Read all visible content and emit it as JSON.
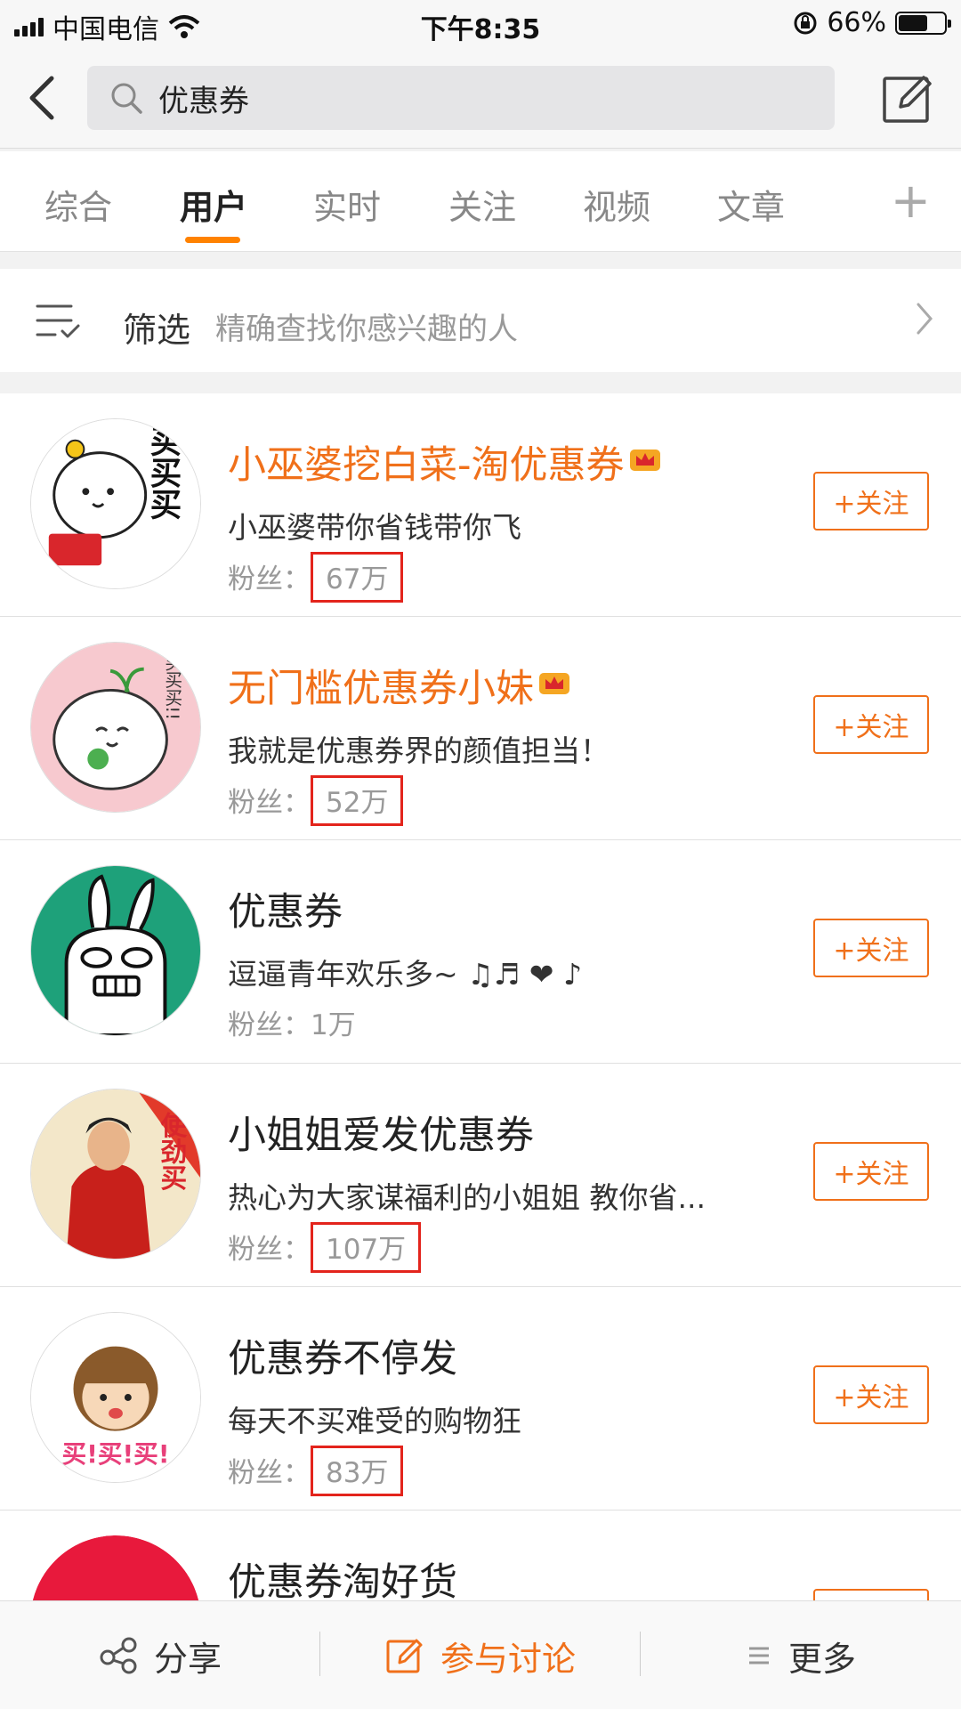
{
  "status_bar": {
    "carrier": "中国电信",
    "time": "下午8:35",
    "battery": "66%",
    "battery_level": 0.66
  },
  "search": {
    "query": "优惠券"
  },
  "tabs": [
    {
      "label": "综合"
    },
    {
      "label": "用户"
    },
    {
      "label": "实时"
    },
    {
      "label": "关注"
    },
    {
      "label": "视频"
    },
    {
      "label": "文章"
    }
  ],
  "tabs_plus": "+",
  "filter": {
    "title": "筛选",
    "hint": "精确查找你感兴趣的人"
  },
  "results": [
    {
      "name": "小巫婆挖白菜-淘优惠券",
      "desc": "小巫婆带你省钱带你飞",
      "fans_label": "粉丝：",
      "fans": "67万",
      "follow": "+关注"
    },
    {
      "name": "无门槛优惠券小妹",
      "desc": "我就是优惠券界的颜值担当！",
      "fans_label": "粉丝：",
      "fans": "52万",
      "follow": "+关注"
    },
    {
      "name": "优惠券",
      "desc": "逗逼青年欢乐多~ ♫♬ ❤ ♪",
      "fans_label": "粉丝：",
      "fans": "1万",
      "follow": "+关注"
    },
    {
      "name": "小姐姐爱发优惠券",
      "desc": "热心为大家谋福利的小姐姐 教你省...",
      "fans_label": "粉丝：",
      "fans": "107万",
      "follow": "+关注"
    },
    {
      "name": "优惠券不停发",
      "desc": "每天不买难受的购物狂",
      "fans_label": "粉丝：",
      "fans": "83万",
      "follow": "+关注"
    },
    {
      "name": "优惠券淘好货"
    }
  ],
  "avatar_text": {
    "a1": "买买买",
    "a2": "买买买!!",
    "a4": "使劲买",
    "a5": "买!买!买!"
  },
  "bottom_bar": {
    "share": "分享",
    "discuss": "参与讨论",
    "more": "更多"
  },
  "colors": {
    "accent": "#f0701a",
    "tab_underline": "#ff8200",
    "highlight_box": "#e3241c"
  }
}
